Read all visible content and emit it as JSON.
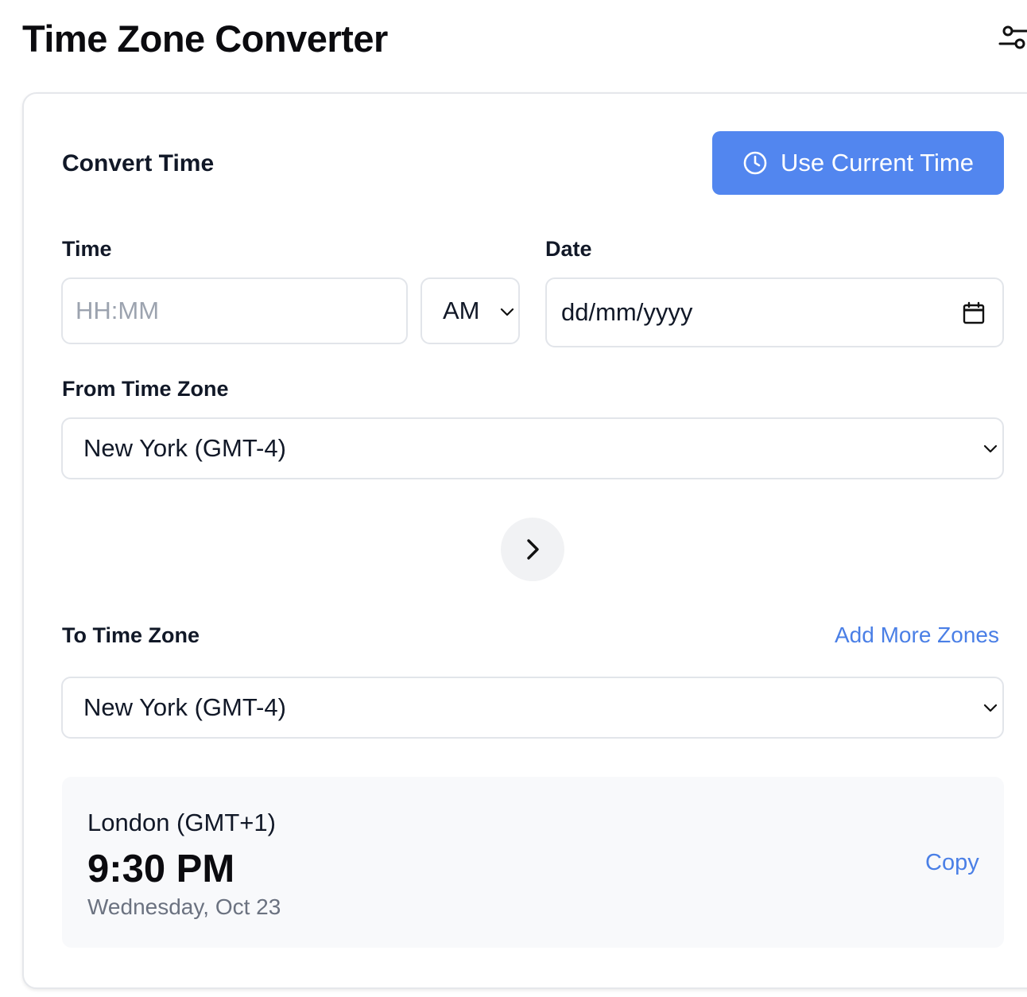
{
  "header": {
    "title": "Time Zone Converter",
    "settings_icon": "sliders-icon"
  },
  "converter": {
    "title": "Convert Time",
    "current_time_button": "Use Current Time",
    "time_label": "Time",
    "time_placeholder": "HH:MM",
    "time_value": "",
    "ampm_value": "AM",
    "date_label": "Date",
    "date_value": "dd/mm/yyyy",
    "from_label": "From Time Zone",
    "from_value": "New York (GMT-4)",
    "to_label": "To Time Zone",
    "add_more_label": "Add More Zones",
    "to_value": "New York (GMT-4)"
  },
  "result": {
    "zone": "London (GMT+1)",
    "time": "9:30 PM",
    "date": "Wednesday, Oct 23",
    "copy_label": "Copy"
  },
  "colors": {
    "accent": "#5286ef",
    "link": "#4a7fe6",
    "result_bg": "#f8f9fb"
  }
}
